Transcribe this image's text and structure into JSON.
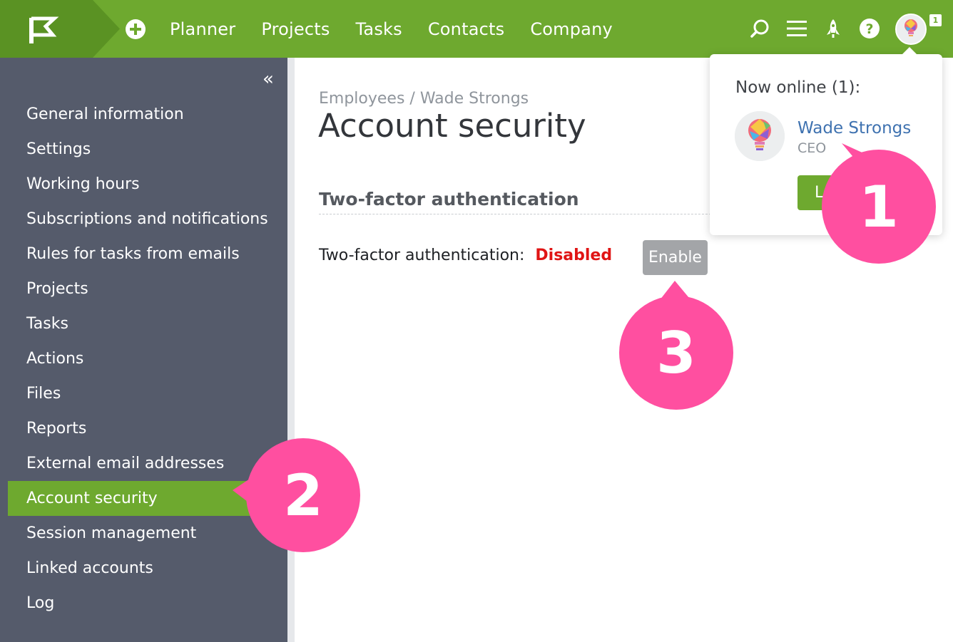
{
  "topbar": {
    "nav": [
      "Planner",
      "Projects",
      "Tasks",
      "Contacts",
      "Company"
    ],
    "notification_count": "1",
    "colors": {
      "accent": "#6ea92f",
      "logo_dark": "#5a9223"
    }
  },
  "icons": {
    "logo": "flag-logo-icon",
    "add": "plus-circle-icon",
    "search": "search-icon",
    "menu": "hamburger-menu-icon",
    "launch": "rocket-icon",
    "help": "question-mark-icon",
    "collapse": "double-chevron-left-icon"
  },
  "sidebar": {
    "collapse_glyph": "«",
    "items": [
      "General information",
      "Settings",
      "Working hours",
      "Subscriptions and notifications",
      "Rules for tasks from emails",
      "Projects",
      "Tasks",
      "Actions",
      "Files",
      "Reports",
      "External email addresses",
      "Account security",
      "Session management",
      "Linked accounts",
      "Log"
    ],
    "active_item": "Account security"
  },
  "main": {
    "breadcrumb": "Employees / Wade Strongs",
    "title": "Account security",
    "section_title": "Two-factor authentication",
    "tfa_label": "Two-factor authentication:",
    "tfa_status": "Disabled",
    "enable_button": "Enable"
  },
  "popup": {
    "title": "Now online (1):",
    "user_name": "Wade Strongs",
    "user_role": "CEO",
    "button_partial": "L"
  },
  "callouts": {
    "one": "1",
    "two": "2",
    "three": "3",
    "color": "#ff4fa0"
  }
}
